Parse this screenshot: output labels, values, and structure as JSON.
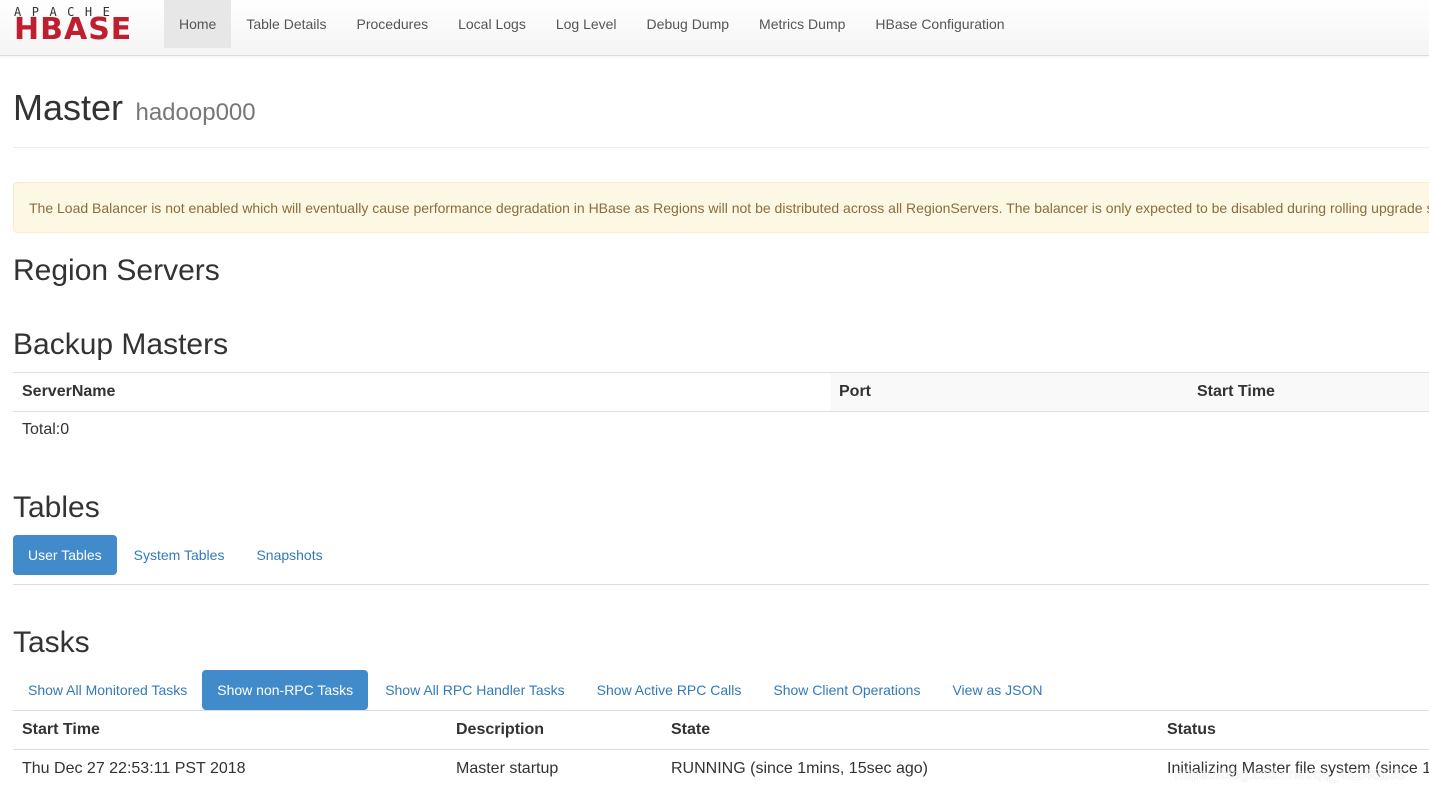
{
  "brand": {
    "top": "APACHE",
    "main": "HBASE",
    "color": "#be1e2d"
  },
  "nav": [
    {
      "label": "Home",
      "active": true
    },
    {
      "label": "Table Details"
    },
    {
      "label": "Procedures"
    },
    {
      "label": "Local Logs"
    },
    {
      "label": "Log Level"
    },
    {
      "label": "Debug Dump"
    },
    {
      "label": "Metrics Dump"
    },
    {
      "label": "HBase Configuration"
    }
  ],
  "header": {
    "title": "Master",
    "host": "hadoop000"
  },
  "alert": "The Load Balancer is not enabled which will eventually cause performance degradation in HBase as Regions will not be distributed across all RegionServers. The balancer is only expected to be disabled during rolling upgrade s",
  "sections": {
    "region_servers": "Region Servers",
    "backup_masters": "Backup Masters",
    "tables": "Tables",
    "tasks": "Tasks"
  },
  "backup_masters": {
    "columns": [
      "ServerName",
      "Port",
      "Start Time"
    ],
    "total": "Total:0"
  },
  "tables_tabs": [
    {
      "label": "User Tables",
      "active": true
    },
    {
      "label": "System Tables"
    },
    {
      "label": "Snapshots"
    }
  ],
  "tasks_tabs": [
    {
      "label": "Show All Monitored Tasks"
    },
    {
      "label": "Show non-RPC Tasks",
      "active": true
    },
    {
      "label": "Show All RPC Handler Tasks"
    },
    {
      "label": "Show Active RPC Calls"
    },
    {
      "label": "Show Client Operations"
    },
    {
      "label": "View as JSON"
    }
  ],
  "tasks": {
    "columns": [
      "Start Time",
      "Description",
      "State",
      "Status"
    ],
    "rows": [
      [
        "Thu Dec 27 22:53:11 PST 2018",
        "Master startup",
        "RUNNING (since 1mins, 15sec ago)",
        "Initializing Master file system (since 1"
      ]
    ]
  },
  "watermark": "https://blog.csdn.net/qq_41245135",
  "colors": {
    "primary": "#428bca",
    "link": "#337ab7",
    "alert_bg": "#fcf8e3",
    "alert_text": "#8a6d3b"
  }
}
